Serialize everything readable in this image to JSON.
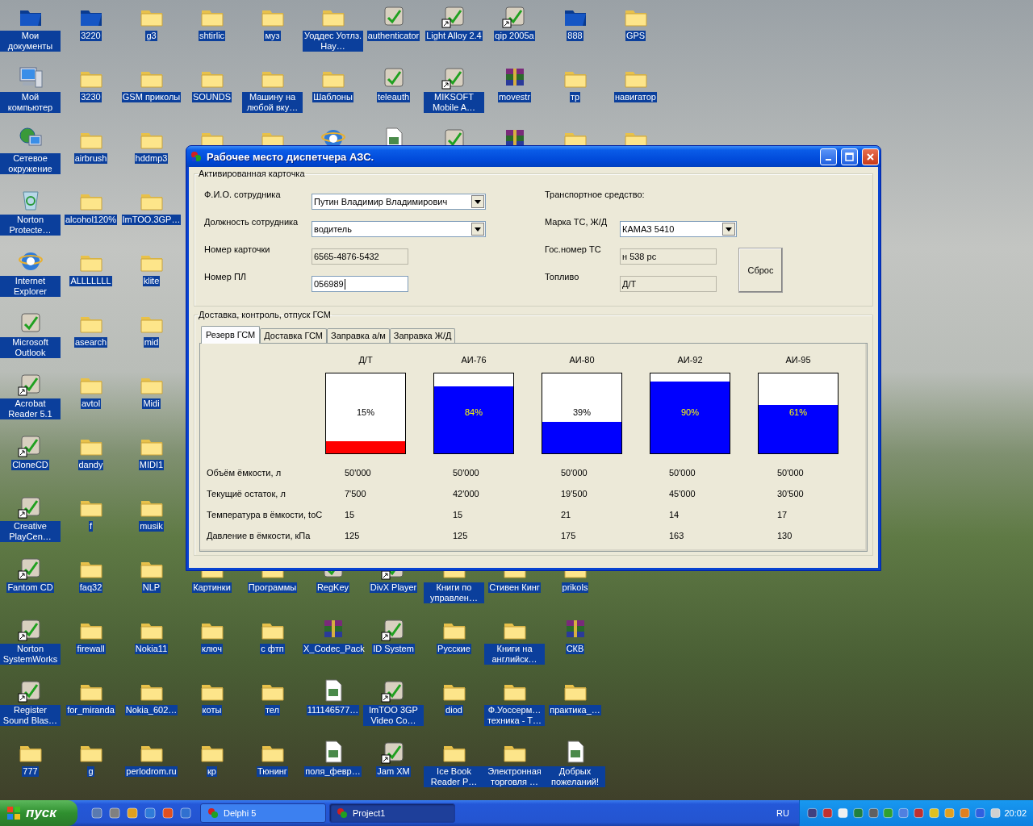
{
  "desktop": {
    "columns": [
      {
        "top": [
          {
            "label": "Мои документы",
            "kind": "special-folder"
          },
          {
            "label": "Мой компьютер",
            "kind": "computer"
          },
          {
            "label": "Сетевое окружение",
            "kind": "network"
          },
          {
            "label": "Norton Protecte…",
            "kind": "recycle"
          },
          {
            "label": "Internet Explorer",
            "kind": "browser"
          },
          {
            "label": "Microsoft Outlook",
            "kind": "program"
          },
          {
            "label": "Acrobat Reader 5.1",
            "kind": "program",
            "shortcut": true
          },
          {
            "label": "CloneCD",
            "kind": "program",
            "shortcut": true
          },
          {
            "label": "Creative PlayCen…",
            "kind": "program",
            "shortcut": true
          },
          {
            "label": "Fantom CD",
            "kind": "program",
            "shortcut": true
          },
          {
            "label": "Norton SystemWorks",
            "kind": "program",
            "shortcut": true
          },
          {
            "label": "Register Sound Blas…",
            "kind": "program",
            "shortcut": true
          },
          {
            "label": "777",
            "kind": "folder"
          }
        ]
      },
      {
        "top": [
          {
            "label": "3220",
            "kind": "special-folder"
          },
          {
            "label": "3230",
            "kind": "folder"
          },
          {
            "label": "airbrush",
            "kind": "folder"
          },
          {
            "label": "alcohol120%",
            "kind": "folder"
          },
          {
            "label": "ALLLLLLL",
            "kind": "folder"
          },
          {
            "label": "asearch",
            "kind": "folder"
          },
          {
            "label": "avtol",
            "kind": "folder"
          },
          {
            "label": "dandy",
            "kind": "folder"
          },
          {
            "label": "f",
            "kind": "folder"
          },
          {
            "label": "faq32",
            "kind": "folder"
          },
          {
            "label": "firewall",
            "kind": "folder"
          },
          {
            "label": "for_miranda",
            "kind": "folder"
          },
          {
            "label": "g",
            "kind": "folder"
          }
        ]
      },
      {
        "top": [
          {
            "label": "g3",
            "kind": "folder"
          },
          {
            "label": "GSM приколы",
            "kind": "folder"
          },
          {
            "label": "hddmp3",
            "kind": "folder"
          },
          {
            "label": "ImTOO.3GP…",
            "kind": "folder"
          },
          {
            "label": "klite",
            "kind": "folder"
          },
          {
            "label": "mid",
            "kind": "folder"
          },
          {
            "label": "Midi",
            "kind": "folder"
          },
          {
            "label": "MIDI1",
            "kind": "folder"
          },
          {
            "label": "musik",
            "kind": "folder"
          },
          {
            "label": "NLP",
            "kind": "folder"
          },
          {
            "label": "Nokia11",
            "kind": "folder"
          },
          {
            "label": "Nokia_602…",
            "kind": "folder"
          },
          {
            "label": "perlodrom.ru",
            "kind": "folder"
          }
        ]
      },
      {
        "top": [
          {
            "label": "shtirlic",
            "kind": "folder"
          },
          {
            "label": "SOUNDS",
            "kind": "folder"
          },
          {
            "kind": "folder"
          }
        ],
        "bottom": [
          {
            "label": "Картинки",
            "kind": "folder"
          },
          {
            "label": "ключ",
            "kind": "folder"
          },
          {
            "label": "коты",
            "kind": "folder"
          },
          {
            "label": "кр",
            "kind": "folder"
          }
        ]
      },
      {
        "top": [
          {
            "label": "муз",
            "kind": "folder"
          },
          {
            "label": "Машину на любой вку…",
            "kind": "folder"
          },
          {
            "kind": "folder"
          }
        ],
        "bottom": [
          {
            "label": "Программы",
            "kind": "folder"
          },
          {
            "label": "с фтп",
            "kind": "folder"
          },
          {
            "label": "тел",
            "kind": "folder"
          },
          {
            "label": "Тюнинг",
            "kind": "folder"
          }
        ]
      },
      {
        "top": [
          {
            "label": "Уоддес Уотлз. Нау…",
            "kind": "folder"
          },
          {
            "label": "Шаблоны",
            "kind": "folder"
          },
          {
            "kind": "browser"
          }
        ],
        "bottom": [
          {
            "label": "RegKey",
            "kind": "program"
          },
          {
            "label": "X_Codec_Pack",
            "kind": "archive"
          },
          {
            "label": "111146577…",
            "kind": "document"
          },
          {
            "label": "поля_февр…",
            "kind": "document"
          }
        ]
      },
      {
        "top": [
          {
            "label": "authenticator",
            "kind": "program"
          },
          {
            "label": "teleauth",
            "kind": "program"
          },
          {
            "kind": "document"
          }
        ],
        "bottom": [
          {
            "label": "DivX Player",
            "kind": "program",
            "shortcut": true
          },
          {
            "label": "ID System",
            "kind": "program",
            "shortcut": true
          },
          {
            "label": "ImTOO 3GP Video Co…",
            "kind": "program",
            "shortcut": true
          },
          {
            "label": "Jam XM",
            "kind": "program",
            "shortcut": true
          }
        ]
      },
      {
        "top": [
          {
            "label": "Light Alloy 2.4",
            "kind": "program",
            "shortcut": true
          },
          {
            "label": "MIKSOFT Mobile A…",
            "kind": "program",
            "shortcut": true
          },
          {
            "kind": "program"
          }
        ],
        "bottom": [
          {
            "label": "Книги по управлен…",
            "kind": "folder"
          },
          {
            "label": "Русские",
            "kind": "folder"
          },
          {
            "label": "diod",
            "kind": "folder"
          },
          {
            "label": "Ice Book Reader P…",
            "kind": "folder"
          }
        ]
      },
      {
        "top": [
          {
            "label": "qip 2005a",
            "kind": "program",
            "shortcut": true
          },
          {
            "label": "movestr",
            "kind": "archive"
          },
          {
            "kind": "archive"
          }
        ],
        "bottom": [
          {
            "label": "Стивен Кинг",
            "kind": "folder"
          },
          {
            "label": "Книги на английск…",
            "kind": "folder"
          },
          {
            "label": "Ф.Уоссерм… техника - Т…",
            "kind": "folder"
          },
          {
            "label": "Электронная торговля …",
            "kind": "folder"
          }
        ]
      },
      {
        "top": [
          {
            "label": "888",
            "kind": "special-folder"
          },
          {
            "label": "тр",
            "kind": "folder"
          },
          {
            "kind": "folder"
          }
        ],
        "bottom": [
          {
            "label": "prikols",
            "kind": "folder"
          },
          {
            "label": "СКВ",
            "kind": "archive"
          },
          {
            "label": "практика_…",
            "kind": "folder"
          },
          {
            "label": "Добрых пожеланий!",
            "kind": "document"
          }
        ]
      },
      {
        "top": [
          {
            "label": "GPS",
            "kind": "folder"
          },
          {
            "label": "навигатор",
            "kind": "folder"
          },
          {
            "kind": "folder"
          }
        ]
      }
    ]
  },
  "window": {
    "title": "Рабочее место диспетчера АЗС.",
    "card_group": {
      "title": "Активированная карточка",
      "fields": [
        {
          "label": "Ф.И.О. сотрудника",
          "kind": "combo",
          "value": "Путин Владимир Владимирович"
        },
        {
          "label": "Должность сотрудника",
          "kind": "combo",
          "value": "водитель"
        },
        {
          "label": "Номер карточки",
          "kind": "readonly",
          "value": "6565-4876-5432"
        },
        {
          "label": "Номер ПЛ",
          "kind": "input",
          "value": "056989"
        }
      ],
      "vehicle_heading": "Транспортное средство:",
      "vehicle_fields": [
        {
          "label": "Марка ТС, Ж/Д",
          "kind": "combo",
          "value": "КАМАЗ 5410"
        },
        {
          "label": "Гос.номер ТС",
          "kind": "readonly",
          "value": "н 538 рс"
        },
        {
          "label": "Топливо",
          "kind": "readonly",
          "value": "Д/Т"
        }
      ],
      "reset_button": "Сброс"
    },
    "fuel_group": {
      "title": "Доставка, контроль, отпуск ГСМ",
      "tabs": [
        {
          "label": "Резерв ГСМ",
          "selected": true
        },
        {
          "label": "Доставка ГСМ",
          "selected": false
        },
        {
          "label": "Заправка а/м",
          "selected": false
        },
        {
          "label": "Заправка Ж/Д",
          "selected": false
        }
      ],
      "tanks": [
        {
          "name": "Д/Т",
          "level": 0.15,
          "reading": "15%",
          "color": "#ff0000"
        },
        {
          "name": "АИ-76",
          "level": 0.84,
          "reading": "84%",
          "color": "#0000ff"
        },
        {
          "name": "АИ-80",
          "level": 0.39,
          "reading": "39%",
          "color": "#0000ff"
        },
        {
          "name": "АИ-92",
          "level": 0.9,
          "reading": "90%",
          "color": "#0000ff"
        },
        {
          "name": "АИ-95",
          "level": 0.61,
          "reading": "61%",
          "color": "#0000ff"
        }
      ],
      "rows": [
        {
          "label": "Объём ёмкости, л",
          "values": [
            "50'000",
            "50'000",
            "50'000",
            "50'000",
            "50'000"
          ]
        },
        {
          "label": "Текущиё остаток, л",
          "values": [
            "7'500",
            "42'000",
            "19'500",
            "45'000",
            "30'500"
          ]
        },
        {
          "label": "Температура в ёмкости, toC",
          "values": [
            "15",
            "15",
            "21",
            "14",
            "17"
          ]
        },
        {
          "label": "Давление в ёмкости, кПа",
          "values": [
            "125",
            "125",
            "175",
            "163",
            "130"
          ]
        }
      ]
    }
  },
  "taskbar": {
    "start": "пуск",
    "tasks": [
      {
        "label": "Delphi 5",
        "selected": false
      },
      {
        "label": "Project1",
        "selected": true
      }
    ],
    "language": "RU",
    "clock": "20:02"
  }
}
